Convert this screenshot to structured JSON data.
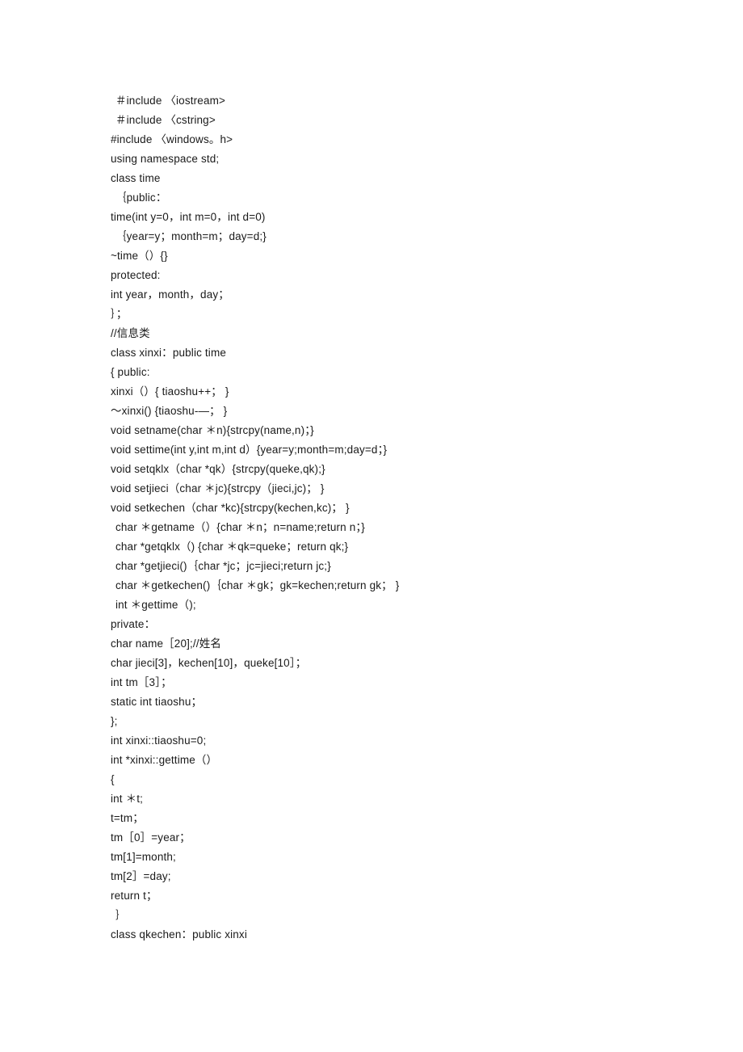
{
  "document": {
    "type": "code-listing",
    "language": "C++",
    "background_color": "#ffffff",
    "text_color": "#1a1a1a",
    "lines": [
      {
        "text": "＃include 〈iostream>",
        "indent": 1
      },
      {
        "text": "＃include 〈cstring>",
        "indent": 1
      },
      {
        "text": "#include 〈windows。h>",
        "indent": 0
      },
      {
        "text": "using namespace std;",
        "indent": 0
      },
      {
        "text": "class time",
        "indent": 0
      },
      {
        "text": "｛public：",
        "indent": 1
      },
      {
        "text": "time(int y=0，int m=0，int d=0)",
        "indent": 0
      },
      {
        "text": "｛year=y；month=m；day=d;}",
        "indent": 1
      },
      {
        "text": "~time（）{}",
        "indent": 0
      },
      {
        "text": "protected:",
        "indent": 0
      },
      {
        "text": "int year，month，day；",
        "indent": 0
      },
      {
        "text": "｝；",
        "indent": 0
      },
      {
        "text": "//信息类",
        "indent": 0
      },
      {
        "text": "class xinxi：public time",
        "indent": 0
      },
      {
        "text": "{ public:",
        "indent": 0
      },
      {
        "text": "xinxi（）{ tiaoshu++； }",
        "indent": 0
      },
      {
        "text": "～xinxi() {tiaoshu-—； }",
        "indent": 0
      },
      {
        "text": "void setname(char ＊n){strcpy(name,n)；}",
        "indent": 0
      },
      {
        "text": "void settime(int y,int m,int d）{year=y;month=m;day=d；}",
        "indent": 0
      },
      {
        "text": "void setqklx（char *qk）{strcpy(queke,qk);}",
        "indent": 0
      },
      {
        "text": "void setjieci（char ＊jc){strcpy（jieci,jc)； }",
        "indent": 0
      },
      {
        "text": "void setkechen（char *kc){strcpy(kechen,kc)； }",
        "indent": 0
      },
      {
        "text": "char ＊getname（）{char ＊n；n=name;return n；}",
        "indent": 1
      },
      {
        "text": "char *getqklx（) {char ＊qk=queke；return qk;}",
        "indent": 1
      },
      {
        "text": "char *getjieci()｛char *jc；jc=jieci;return jc;}",
        "indent": 1
      },
      {
        "text": "char ＊getkechen()｛char ＊gk；gk=kechen;return gk； }",
        "indent": 1
      },
      {
        "text": "int ＊gettime（);",
        "indent": 1
      },
      {
        "text": "private：",
        "indent": 0
      },
      {
        "text": "char name［20];//姓名",
        "indent": 0
      },
      {
        "text": "char jieci[3]，kechen[10]，queke[10］；",
        "indent": 0
      },
      {
        "text": "int tm［3］；",
        "indent": 0
      },
      {
        "text": "static int tiaoshu；",
        "indent": 0
      },
      {
        "text": "};",
        "indent": 0
      },
      {
        "text": "int xinxi::tiaoshu=0;",
        "indent": 0
      },
      {
        "text": "int *xinxi::gettime（）",
        "indent": 0
      },
      {
        "text": "{",
        "indent": 0
      },
      {
        "text": "int ＊t;",
        "indent": 0
      },
      {
        "text": "t=tm；",
        "indent": 0
      },
      {
        "text": "tm［0］=year；",
        "indent": 0
      },
      {
        "text": "tm[1]=month;",
        "indent": 0
      },
      {
        "text": "tm[2］=day;",
        "indent": 0
      },
      {
        "text": "return t；",
        "indent": 0
      },
      {
        "text": "｝",
        "indent": 1
      },
      {
        "text": "class qkechen：public xinxi",
        "indent": 0
      }
    ]
  }
}
